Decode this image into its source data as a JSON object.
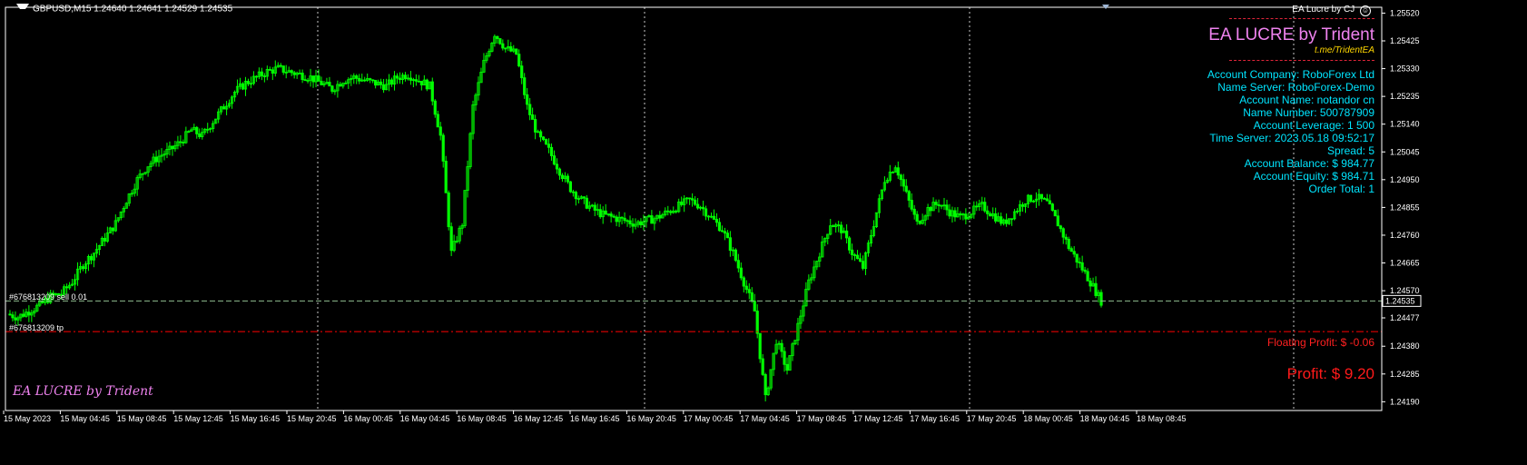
{
  "header": {
    "symbol_info": "GBPUSD,M15  1.24640 1.24641 1.24529 1.24535",
    "ea_badge": "EA Lucre by CJ",
    "smiley_icon": "smiley-icon"
  },
  "ea_panel": {
    "title": "EA LUCRE by Trident",
    "link": "t.me/TridentEA",
    "lines": [
      "Account Company: RoboForex Ltd",
      "Name Server: RoboForex-Demo",
      "Account Name: notandor cn",
      "Name Number: 500787909",
      "Account Leverage: 1 500",
      "Time Server: 2023.05.18 09:52:17",
      "Spread: 5",
      "Account Balance: $ 984.77",
      "Account Equity: $ 984.71",
      "Order Total: 1"
    ],
    "floating_profit": "Floating Profit: $ -0.06",
    "profit": "Profit: $ 9.20",
    "watermark": "EA LUCRE by Trident"
  },
  "orders": {
    "sell_label": "#676813209 sell 0.01",
    "tp_label": "#676813209 tp",
    "current_price_label": "1.24535"
  },
  "colors": {
    "background": "#000000",
    "candle": "#00ff00",
    "grid": "#c8c8c8",
    "order_line": "#8fbc8f",
    "tp_line": "#ff0000",
    "panel_text": "#00e5ff",
    "title": "#ee82ee",
    "link": "#ffd700",
    "profit": "#ff0000"
  },
  "chart_data": {
    "type": "candlestick",
    "symbol": "GBPUSD",
    "timeframe": "M15",
    "ohlc_current": {
      "open": 1.2464,
      "high": 1.24641,
      "low": 1.24529,
      "close": 1.24535
    },
    "ylim": [
      1.2416,
      1.2554
    ],
    "y_ticks": [
      "1.25520",
      "1.25425",
      "1.25330",
      "1.25235",
      "1.25140",
      "1.25045",
      "1.24950",
      "1.24855",
      "1.24760",
      "1.24665",
      "1.24570",
      "1.24477",
      "1.24380",
      "1.24285",
      "1.24190"
    ],
    "y_tick_values": [
      1.2552,
      1.25425,
      1.2533,
      1.25235,
      1.2514,
      1.25045,
      1.2495,
      1.24855,
      1.2476,
      1.24665,
      1.2457,
      1.24477,
      1.2438,
      1.24285,
      1.2419
    ],
    "x_ticks": [
      "15 May 2023",
      "15 May 04:45",
      "15 May 08:45",
      "15 May 12:45",
      "15 May 16:45",
      "15 May 20:45",
      "16 May 00:45",
      "16 May 04:45",
      "16 May 08:45",
      "16 May 12:45",
      "16 May 16:45",
      "16 May 20:45",
      "17 May 00:45",
      "17 May 04:45",
      "17 May 08:45",
      "17 May 12:45",
      "17 May 16:45",
      "17 May 20:45",
      "18 May 00:45",
      "18 May 04:45",
      "18 May 08:45"
    ],
    "order_price": 1.24535,
    "tp_price": 1.2443,
    "current_price": 1.24535,
    "grid": "vertical-dotted",
    "series_close": [
      1.2449,
      1.2448,
      1.245,
      1.2452,
      1.2455,
      1.2456,
      1.246,
      1.2466,
      1.247,
      1.2475,
      1.248,
      1.2488,
      1.2495,
      1.25,
      1.2503,
      1.2505,
      1.2508,
      1.2512,
      1.251,
      1.2515,
      1.252,
      1.2525,
      1.2528,
      1.253,
      1.2532,
      1.2533,
      1.2532,
      1.2531,
      1.253,
      1.2528,
      1.2526,
      1.2529,
      1.253,
      1.2529,
      1.2528,
      1.2527,
      1.253,
      1.2531,
      1.2529,
      1.2527,
      1.251,
      1.247,
      1.248,
      1.252,
      1.2535,
      1.2545,
      1.254,
      1.2538,
      1.252,
      1.251,
      1.2505,
      1.2498,
      1.2492,
      1.2488,
      1.2485,
      1.2483,
      1.2482,
      1.2481,
      1.248,
      1.2481,
      1.2482,
      1.2484,
      1.2486,
      1.2488,
      1.2486,
      1.2482,
      1.2478,
      1.247,
      1.246,
      1.245,
      1.242,
      1.244,
      1.243,
      1.2445,
      1.246,
      1.247,
      1.248,
      1.2478,
      1.247,
      1.2465,
      1.248,
      1.2495,
      1.25,
      1.249,
      1.248,
      1.2485,
      1.2487,
      1.2484,
      1.2482,
      1.2484,
      1.2486,
      1.2483,
      1.248,
      1.2484,
      1.2488,
      1.2489,
      1.2487,
      1.248,
      1.2472,
      1.2466,
      1.246,
      1.24535
    ]
  }
}
